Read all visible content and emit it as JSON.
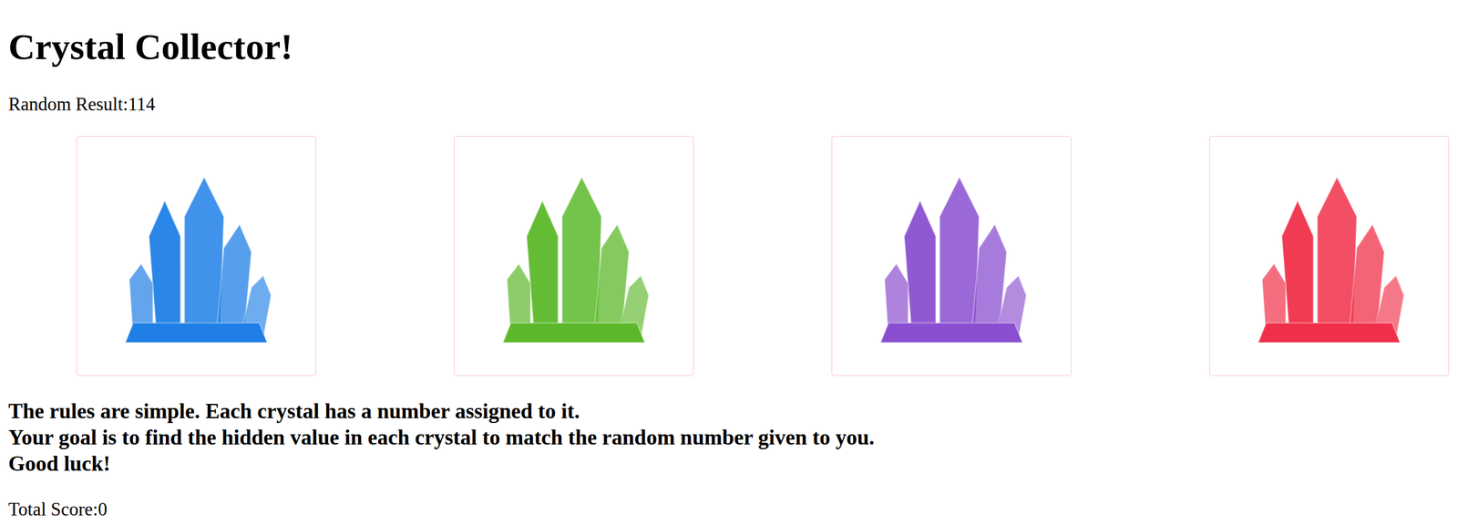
{
  "title": "Crystal Collector!",
  "random_result": {
    "label": "Random Result:",
    "value": "114"
  },
  "crystals": [
    {
      "color": "#1f7fe6"
    },
    {
      "color": "#5cb82a"
    },
    {
      "color": "#8a4fd0"
    },
    {
      "color": "#f0304a"
    }
  ],
  "rules": [
    "The rules are simple. Each crystal has a number assigned to it.",
    "Your goal is to find the hidden value in each crystal to match the random number given to you.",
    "Good luck!"
  ],
  "total_score": {
    "label": "Total Score:",
    "value": "0"
  }
}
